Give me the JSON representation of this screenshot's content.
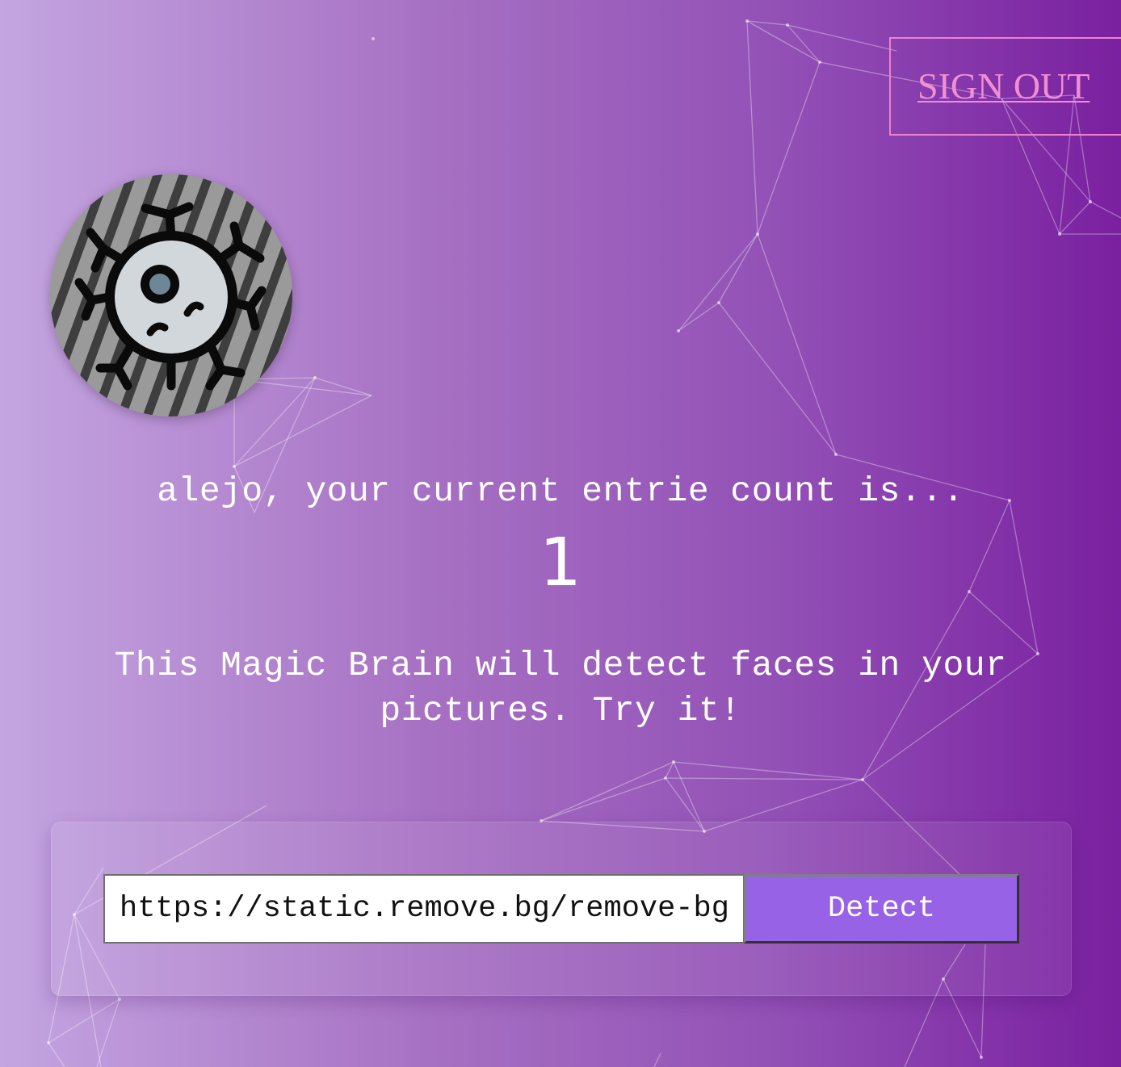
{
  "nav": {
    "sign_out_label": "SIGN OUT"
  },
  "logo": {
    "icon": "brain-cell-icon"
  },
  "rank": {
    "greeting": "alejo, your current entrie count is...",
    "count": "1"
  },
  "intro": {
    "text": "This Magic Brain will detect faces in your pictures. Try it!"
  },
  "form": {
    "image_url_value": "https://static.remove.bg/remove-bg-web/",
    "detect_label": "Detect"
  },
  "colors": {
    "background_start": "#c4a5e1",
    "background_end": "#7a20a0",
    "sign_out": "#f08fd2",
    "detect_button": "#9762e6"
  }
}
